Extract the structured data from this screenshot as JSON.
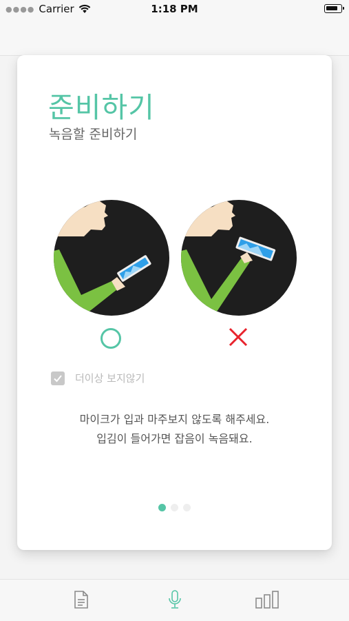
{
  "status_bar": {
    "carrier": "Carrier",
    "time": "1:18 PM"
  },
  "card": {
    "title": "준비하기",
    "subtitle": "녹음할 준비하기",
    "checkbox_label": "더이상 보지않기",
    "checkbox_checked": true,
    "instruction_line1": "마이크가 입과 마주보지 않도록 해주세요.",
    "instruction_line2": "입김이 들어가면 잡음이 녹음돼요.",
    "page_indicator": {
      "current": 1,
      "total": 3
    }
  },
  "tab_bar": {
    "tabs": [
      {
        "icon": "document-icon",
        "selected": false
      },
      {
        "icon": "microphone-icon",
        "selected": true
      },
      {
        "icon": "bar-chart-icon",
        "selected": false
      }
    ]
  },
  "colors": {
    "accent": "#55c5a6",
    "wrong": "#e8222c",
    "shirt": "#1e1e1e",
    "sleeve": "#7bc142",
    "skin": "#f6dfc3",
    "screen": "#2f9fe8"
  }
}
